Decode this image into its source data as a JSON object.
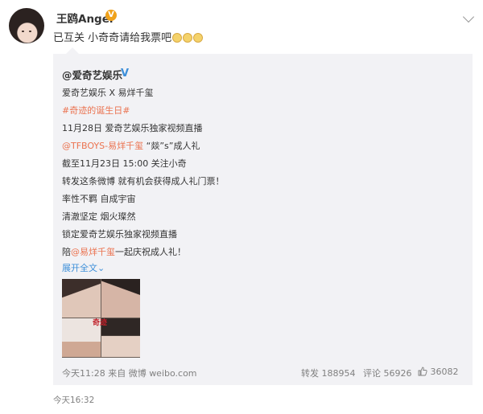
{
  "post": {
    "username": "王鸥Angel",
    "verified_badge": "V",
    "text": "已互关 小奇奇请给我票吧",
    "menu_icon": "chevron-down-icon"
  },
  "repost": {
    "author": "@爱奇艺娱乐",
    "author_badge": "V",
    "lines": [
      "爱奇艺娱乐 X 易烊千玺",
      "#奇迹的诞生日#",
      "11月28日 爱奇艺娱乐独家视频直播",
      "@TFBOYS-易烊千玺",
      " “燚”s”成人礼",
      "截至11月23日 15:00 关注小奇",
      "转发这条微博 就有机会获得成人礼门票！",
      "率性不羁 自成宇宙",
      "清澈坚定 烟火璨然",
      "锁定爱奇艺娱乐独家视频直播",
      "陪",
      "@易烊千玺",
      "一起庆祝成人礼！",
      "展开全文",
      "⌄"
    ],
    "image_text": "奇迹",
    "footer": {
      "time_source": "今天11:28 来自 微博 weibo.com",
      "repost_label": "转发 188954",
      "comment_label": "评论 56926",
      "like_icon": "thumbs-up-icon",
      "like_count": "36082"
    }
  },
  "timestamp": "今天16:32"
}
